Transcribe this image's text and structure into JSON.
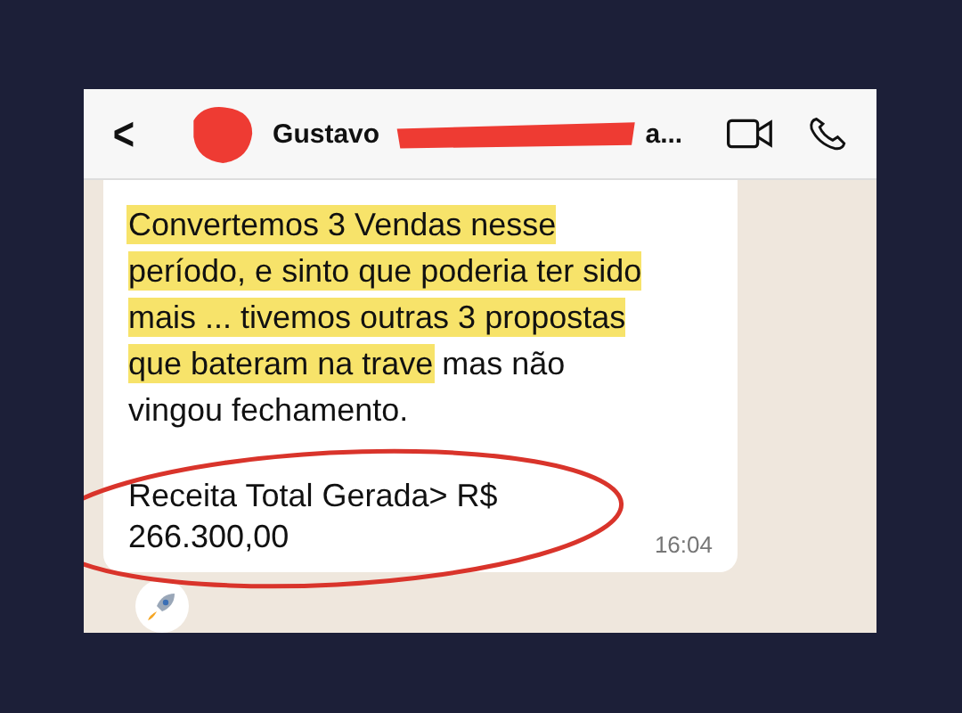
{
  "header": {
    "back": "<",
    "name": "Gustavo",
    "name_tail": "a..."
  },
  "message": {
    "segments": [
      {
        "text": "Convertemos 3 Vendas nesse período, e sinto que poderia ter sido mais ... tivemos outras 3 propostas que bateram na trave",
        "highlighted": true
      },
      {
        "text": " mas não vingou fechamento.",
        "highlighted": false
      }
    ],
    "total": "Receita Total Gerada> R$ 266.300,00",
    "time": "16:04"
  }
}
